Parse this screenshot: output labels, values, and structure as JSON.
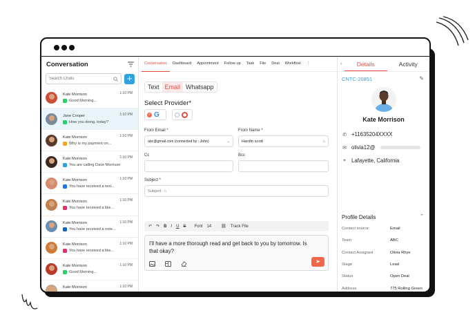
{
  "left": {
    "title": "Conversation",
    "search_placeholder": "Search Chats",
    "chats": [
      {
        "name": "Kate Morrison",
        "time": "1:10 PM",
        "preview": "Good Morning...",
        "channel": "whatsapp-icon",
        "channel_color": "#25d366",
        "avatar_color": "#c94f3a"
      },
      {
        "name": "Jane Cooper",
        "time": "1:10 PM",
        "preview": "How you doing, today?",
        "channel": "whatsapp-icon",
        "channel_color": "#25d366",
        "avatar_color": "#7b8a99"
      },
      {
        "name": "Kate Morrison",
        "time": "1:10 PM",
        "preview": "Why is my payment on...",
        "channel": "email-icon",
        "channel_color": "#f5a623",
        "avatar_color": "#5a3a2a"
      },
      {
        "name": "Kate Morrison",
        "time": "1:10 PM",
        "preview": "You are calling Dave Morrison",
        "channel": "phone-icon",
        "channel_color": "#2fa3e0",
        "avatar_color": "#3a2a22"
      },
      {
        "name": "Kate Morrison",
        "time": "1:10 PM",
        "preview": "You have received a text...",
        "channel": "facebook-icon",
        "channel_color": "#1877f2",
        "avatar_color": "#d88a70"
      },
      {
        "name": "Kate Morrison",
        "time": "1:10 PM",
        "preview": "You have received a like...",
        "channel": "instagram-icon",
        "channel_color": "#e1306c",
        "avatar_color": "#c08050"
      },
      {
        "name": "Kate Morrison",
        "time": "1:10 PM",
        "preview": "You have received a note...",
        "channel": "linkedin-icon",
        "channel_color": "#0a66c2",
        "avatar_color": "#6a8fb0"
      },
      {
        "name": "Kate Morrison",
        "time": "1:10 PM",
        "preview": "You have received a like...",
        "channel": "instagram-icon",
        "channel_color": "#e1306c",
        "avatar_color": "#d07a3a"
      },
      {
        "name": "Kate Morrison",
        "time": "1:10 PM",
        "preview": "Good Morning...",
        "channel": "whatsapp-icon",
        "channel_color": "#25d366",
        "avatar_color": "#b83a2a"
      },
      {
        "name": "Kate Morrison",
        "time": "1:10 PM",
        "preview": "You have received a text...",
        "channel": "facebook-icon",
        "channel_color": "#1877f2",
        "avatar_color": "#c9a58a"
      }
    ]
  },
  "center": {
    "tabs": [
      "Conversation",
      "Dashboard",
      "Appointment",
      "Follow up",
      "Task",
      "File",
      "Deal",
      "Workflow"
    ],
    "channel_tabs": [
      "Text",
      "Email",
      "Whatsapp"
    ],
    "select_provider_label": "Select Provider*",
    "from_email_label": "From Email *",
    "from_email_value": "abc@gmail.com (connected by : John)",
    "from_name_label": "From Name *",
    "from_name_value": "Hardin scott",
    "cc_label": "Cc",
    "bcc_label": "Bcc",
    "subject_label": "Subject *",
    "subject_placeholder": "Subject",
    "toolbar": {
      "bold": "B",
      "italic": "I",
      "underline": "U",
      "strike": "S",
      "font": "Font",
      "size": "14",
      "track": "Track File"
    },
    "compose_text": "I'll have a more thorough read and get back to you by tomorrow. Is that okay?"
  },
  "right": {
    "tabs": [
      "Details",
      "Activity"
    ],
    "contact_id": "CNTC-20851",
    "name": "Kate Morrison",
    "phone": "+11635204XXXX",
    "email": "olivia12@",
    "location": "Lafayette, California",
    "profile_title": "Profile Details",
    "details": [
      {
        "key": "Contact source",
        "value": "Email"
      },
      {
        "key": "Team",
        "value": "ABC"
      },
      {
        "key": "Contact Assigned",
        "value": "Olivia Rhye"
      },
      {
        "key": "Stage",
        "value": "Lead"
      },
      {
        "key": "Status",
        "value": "Open Deal"
      },
      {
        "key": "Address",
        "value": "775 Rolling Green"
      },
      {
        "key": "City",
        "value": "California"
      }
    ]
  },
  "colors": {
    "accent": "#e8493f",
    "blue": "#2fa3e0",
    "send": "#f26649"
  }
}
